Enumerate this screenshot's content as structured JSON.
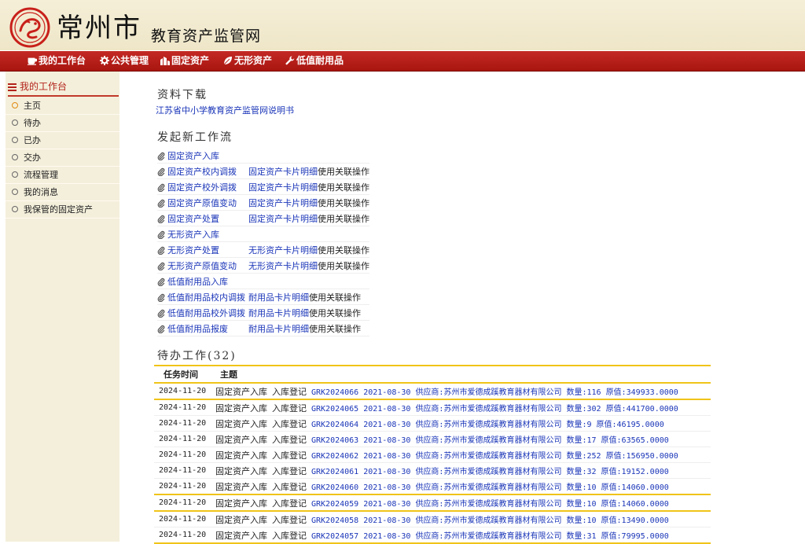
{
  "header": {
    "city": "常州市",
    "site_name": "教育资产监管网",
    "colors": {
      "seal": "#c8201a",
      "nav": "#b51d17",
      "accent": "#f0c419"
    }
  },
  "nav": [
    {
      "label": "我的工作台",
      "icon": "cup-icon"
    },
    {
      "label": "公共管理",
      "icon": "gear-icon"
    },
    {
      "label": "固定资产",
      "icon": "building-icon"
    },
    {
      "label": "无形资产",
      "icon": "leaf-icon"
    },
    {
      "label": "低值耐用品",
      "icon": "wrench-icon"
    }
  ],
  "sidebar": {
    "title": "我的工作台",
    "items": [
      {
        "label": "主页",
        "active": true
      },
      {
        "label": "待办"
      },
      {
        "label": "已办"
      },
      {
        "label": "交办"
      },
      {
        "label": "流程管理"
      },
      {
        "label": "我的消息"
      },
      {
        "label": "我保管的固定资产"
      }
    ]
  },
  "downloads": {
    "title": "资料下载",
    "link": "江苏省中小学教育资产监管网说明书"
  },
  "workflow": {
    "title": "发起新工作流",
    "rows": [
      {
        "name": "固定资产入库",
        "link": "",
        "suffix": ""
      },
      {
        "name": "固定资产校内调拨",
        "link": "固定资产卡片明细",
        "suffix": "使用关联操作"
      },
      {
        "name": "固定资产校外调拨",
        "link": "固定资产卡片明细",
        "suffix": "使用关联操作"
      },
      {
        "name": "固定资产原值变动",
        "link": "固定资产卡片明细",
        "suffix": "使用关联操作"
      },
      {
        "name": "固定资产处置",
        "link": "固定资产卡片明细",
        "suffix": "使用关联操作"
      },
      {
        "name": "无形资产入库",
        "link": "",
        "suffix": ""
      },
      {
        "name": "无形资产处置",
        "link": "无形资产卡片明细",
        "suffix": "使用关联操作"
      },
      {
        "name": "无形资产原值变动",
        "link": "无形资产卡片明细",
        "suffix": "使用关联操作"
      },
      {
        "name": "低值耐用品入库",
        "link": "",
        "suffix": ""
      },
      {
        "name": "低值耐用品校内调拨",
        "link": "耐用品卡片明细",
        "suffix": "使用关联操作"
      },
      {
        "name": "低值耐用品校外调拨",
        "link": "耐用品卡片明细",
        "suffix": "使用关联操作"
      },
      {
        "name": "低值耐用品报废",
        "link": "耐用品卡片明细",
        "suffix": "使用关联操作"
      }
    ]
  },
  "todo": {
    "title": "待办工作(32)",
    "headers": {
      "time": "任务时间",
      "subject": "主题"
    },
    "rows": [
      {
        "time": "2024-11-20",
        "type": "固定资产入库",
        "step": "入库登记",
        "code": "GRK2024066",
        "date": "2021-08-30",
        "supplier": "供应商:苏州市爱德成蹊教育器材有限公司",
        "qty": "数量:116",
        "price": "原值:349933.0000"
      },
      {
        "time": "2024-11-20",
        "type": "固定资产入库",
        "step": "入库登记",
        "code": "GRK2024065",
        "date": "2021-08-30",
        "supplier": "供应商:苏州市爱德成蹊教育器材有限公司",
        "qty": "数量:302",
        "price": "原值:441700.0000"
      },
      {
        "time": "2024-11-20",
        "type": "固定资产入库",
        "step": "入库登记",
        "code": "GRK2024064",
        "date": "2021-08-30",
        "supplier": "供应商:苏州市爱德成蹊教育器材有限公司",
        "qty": "数量:9",
        "price": "原值:46195.0000"
      },
      {
        "time": "2024-11-20",
        "type": "固定资产入库",
        "step": "入库登记",
        "code": "GRK2024063",
        "date": "2021-08-30",
        "supplier": "供应商:苏州市爱德成蹊教育器材有限公司",
        "qty": "数量:17",
        "price": "原值:63565.0000"
      },
      {
        "time": "2024-11-20",
        "type": "固定资产入库",
        "step": "入库登记",
        "code": "GRK2024062",
        "date": "2021-08-30",
        "supplier": "供应商:苏州市爱德成蹊教育器材有限公司",
        "qty": "数量:252",
        "price": "原值:156950.0000"
      },
      {
        "time": "2024-11-20",
        "type": "固定资产入库",
        "step": "入库登记",
        "code": "GRK2024061",
        "date": "2021-08-30",
        "supplier": "供应商:苏州市爱德成蹊教育器材有限公司",
        "qty": "数量:32",
        "price": "原值:19152.0000"
      },
      {
        "time": "2024-11-20",
        "type": "固定资产入库",
        "step": "入库登记",
        "code": "GRK2024060",
        "date": "2021-08-30",
        "supplier": "供应商:苏州市爱德成蹊教育器材有限公司",
        "qty": "数量:10",
        "price": "原值:14060.0000"
      },
      {
        "time": "2024-11-20",
        "type": "固定资产入库",
        "step": "入库登记",
        "code": "GRK2024059",
        "date": "2021-08-30",
        "supplier": "供应商:苏州市爱德成蹊教育器材有限公司",
        "qty": "数量:10",
        "price": "原值:14060.0000"
      },
      {
        "time": "2024-11-20",
        "type": "固定资产入库",
        "step": "入库登记",
        "code": "GRK2024058",
        "date": "2021-08-30",
        "supplier": "供应商:苏州市爱德成蹊教育器材有限公司",
        "qty": "数量:10",
        "price": "原值:13490.0000"
      },
      {
        "time": "2024-11-20",
        "type": "固定资产入库",
        "step": "入库登记",
        "code": "GRK2024057",
        "date": "2021-08-30",
        "supplier": "供应商:苏州市爱德成蹊教育器材有限公司",
        "qty": "数量:31",
        "price": "原值:79995.0000"
      }
    ]
  }
}
